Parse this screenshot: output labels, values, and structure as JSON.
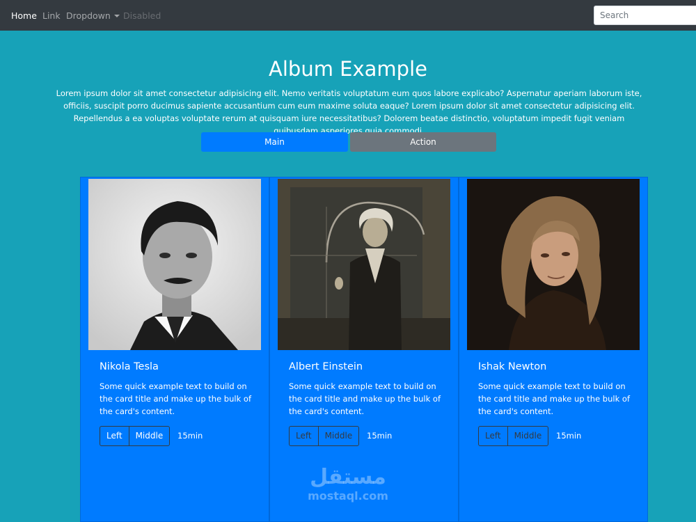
{
  "navbar": {
    "home": "Home",
    "link": "Link",
    "dropdown": "Dropdown",
    "disabled": "Disabled",
    "search_placeholder": "Search"
  },
  "hero": {
    "title": "Album Example",
    "lead": "Lorem ipsum dolor sit amet consectetur adipisicing elit. Nemo veritatis voluptatum eum quos labore explicabo? Aspernatur aperiam laborum iste, officiis, suscipit porro ducimus sapiente accusantium cum eum maxime soluta eaque? Lorem ipsum dolor sit amet consectetur adipisicing elit. Repellendus a ea voluptas voluptate rerum at quisquam iure necessitatibus? Dolorem beatae distinctio, voluptatum impedit fugit veniam quibusdam asperiores quia commodi.",
    "main_button": "Main",
    "action_button": "Action"
  },
  "cards": [
    {
      "title": "Nikola Tesla",
      "text": "Some quick example text to build on the card title and make up the bulk of the card's content.",
      "left": "Left",
      "middle": "Middle",
      "duration": "15min",
      "image": "nikola-tesla-portrait"
    },
    {
      "title": "Albert Einstein",
      "text": "Some quick example text to build on the card title and make up the bulk of the card's content.",
      "left": "Left",
      "middle": "Middle",
      "duration": "15min",
      "image": "albert-einstein-portrait"
    },
    {
      "title": "Ishak Newton",
      "text": "Some quick example text to build on the card title and make up the bulk of the card's content.",
      "left": "Left",
      "middle": "Middle",
      "duration": "15min",
      "image": "isaac-newton-portrait"
    }
  ],
  "watermark": {
    "arabic": "مستقل",
    "latin": "mostaql.com"
  },
  "colors": {
    "background": "#17a2b8",
    "navbar": "#343a40",
    "primary": "#007bff",
    "secondary": "#6c757d"
  }
}
